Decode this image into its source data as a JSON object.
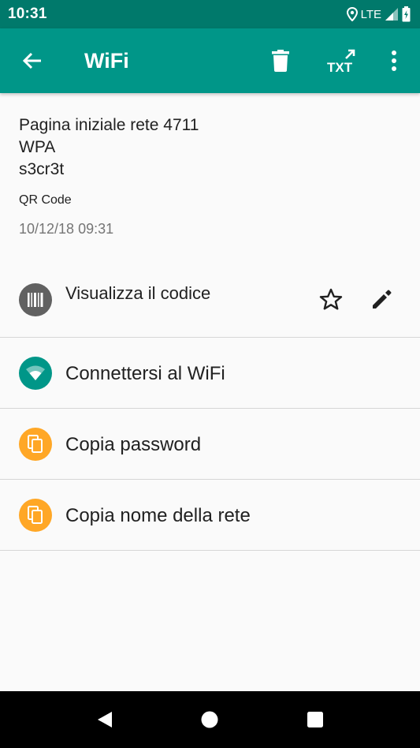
{
  "status_bar": {
    "time": "10:31",
    "network": "LTE"
  },
  "app_bar": {
    "title": "WiFi",
    "icons": [
      "back-arrow-icon",
      "delete-icon",
      "txt-export-icon",
      "more-vert-icon"
    ],
    "color": "#009688"
  },
  "scan": {
    "lines": [
      "Pagina iniziale rete 4711",
      "WPA",
      "s3cr3t"
    ],
    "format": "QR Code",
    "timestamp": "10/12/18 09:31"
  },
  "actions": [
    {
      "label": "Visualizza il codice",
      "icon": "barcode-icon",
      "color": "#616161"
    },
    {
      "label": "Connettersi al WiFi",
      "icon": "wifi-icon",
      "color": "#009688"
    },
    {
      "label": "Copia password",
      "icon": "copy-icon",
      "color": "#ffa726"
    },
    {
      "label": "Copia nome della rete",
      "icon": "copy-icon",
      "color": "#ffa726"
    }
  ],
  "row_icons": [
    "star-outline-icon",
    "edit-pencil-icon"
  ],
  "nav_bar": {
    "icons": [
      "back-triangle-icon",
      "home-circle-icon",
      "recents-square-icon"
    ]
  }
}
